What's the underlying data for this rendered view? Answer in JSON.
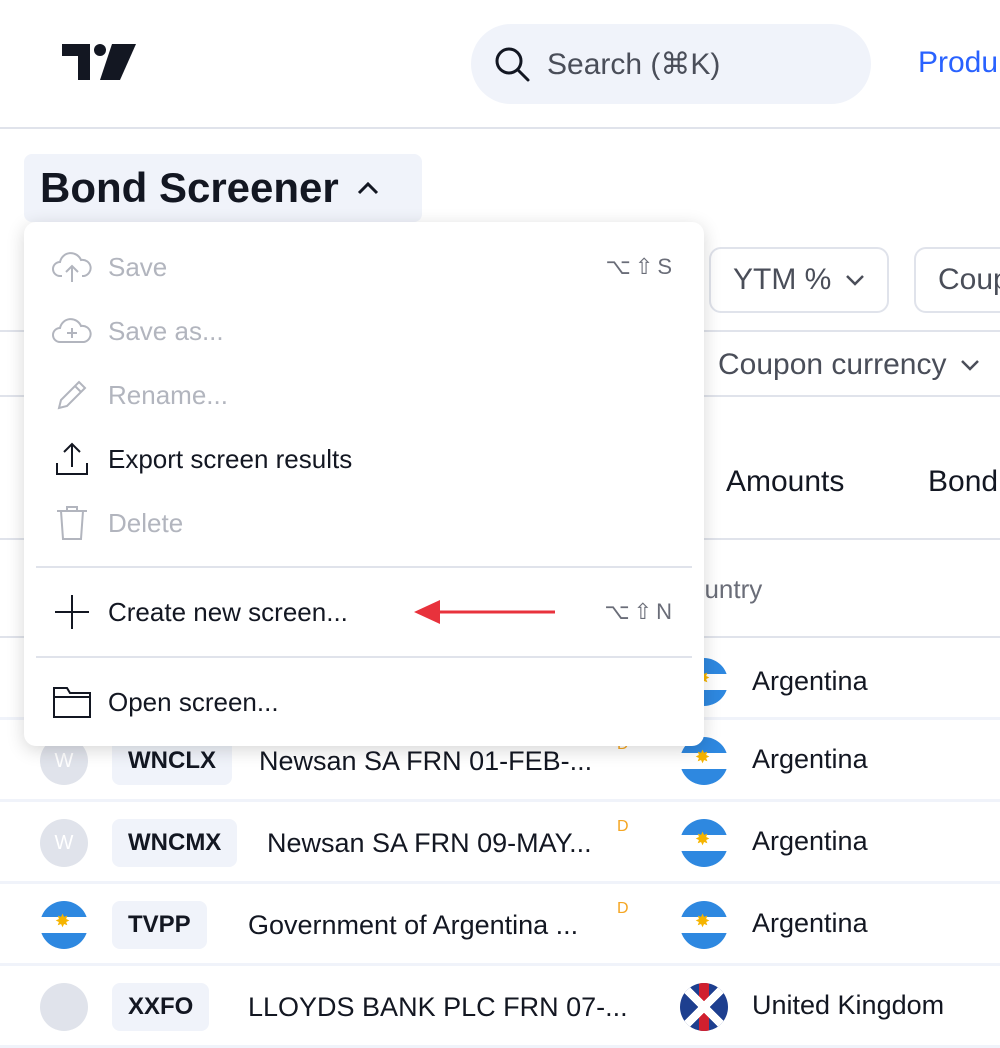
{
  "header": {
    "search_placeholder": "Search (⌘K)",
    "nav_products": "Produ"
  },
  "title": "Bond Screener",
  "filters": {
    "ytm": "YTM %",
    "coupon": "Coup",
    "coupon_currency": "Coupon currency"
  },
  "tabs": [
    "Amounts",
    "Bond"
  ],
  "column_header": "ountry",
  "menu": {
    "items": [
      {
        "label": "Save",
        "icon": "cloud-upload-icon",
        "disabled": true,
        "shortcut": "⌥⇧S"
      },
      {
        "label": "Save as...",
        "icon": "cloud-plus-icon",
        "disabled": true
      },
      {
        "label": "Rename...",
        "icon": "pencil-icon",
        "disabled": true
      },
      {
        "label": "Export screen results",
        "icon": "export-icon",
        "disabled": false
      },
      {
        "label": "Delete",
        "icon": "trash-icon",
        "disabled": true
      },
      {
        "label": "Create new screen...",
        "icon": "plus-icon",
        "disabled": false,
        "shortcut": "⌥⇧N"
      },
      {
        "label": "Open screen...",
        "icon": "folder-icon",
        "disabled": false
      }
    ]
  },
  "annotation": {
    "arrow_color": "#e8323c"
  },
  "rows": [
    {
      "avatar": "",
      "ticker": "",
      "name": "",
      "badge": "",
      "country": "Argentina"
    },
    {
      "avatar": "W",
      "ticker": "WNCLX",
      "name": "Newsan SA FRN 01-FEB-...",
      "badge": "D",
      "country": "Argentina"
    },
    {
      "avatar": "W",
      "ticker": "WNCMX",
      "name": "Newsan SA FRN 09-MAY...",
      "badge": "D",
      "country": "Argentina"
    },
    {
      "avatar": "",
      "ticker": "TVPP",
      "name": "Government of Argentina ...",
      "badge": "D",
      "country": "Argentina"
    },
    {
      "avatar": "",
      "ticker": "XXFO",
      "name": "LLOYDS BANK PLC FRN 07-...",
      "badge": "",
      "country": "United Kingdom"
    }
  ],
  "colors": {
    "accent": "#2962ff",
    "badge": "#f5a623",
    "chip_bg": "#f0f3fa"
  }
}
